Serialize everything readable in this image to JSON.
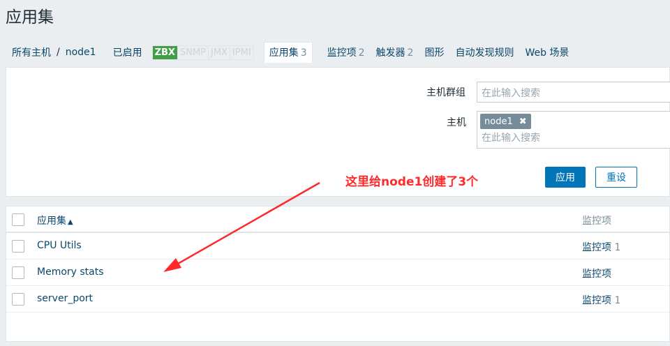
{
  "page": {
    "title": "应用集"
  },
  "nav": {
    "all_hosts": "所有主机",
    "separator": "/",
    "host": "node1",
    "status": "已启用",
    "availability": [
      "ZBX",
      "SNMP",
      "JMX",
      "IPMI"
    ],
    "tabs": [
      {
        "label": "应用集",
        "count": "3",
        "active": true
      },
      {
        "label": "监控项",
        "count": "2",
        "active": false
      },
      {
        "label": "触发器",
        "count": "2",
        "active": false
      },
      {
        "label": "图形",
        "count": "",
        "active": false
      },
      {
        "label": "自动发现规则",
        "count": "",
        "active": false
      },
      {
        "label": "Web 场景",
        "count": "",
        "active": false
      }
    ]
  },
  "filter": {
    "host_group_label": "主机群组",
    "host_group_placeholder": "在此输入搜索",
    "host_label": "主机",
    "host_chip": "node1",
    "host_chip_remove": "✖",
    "host_placeholder": "在此输入搜索",
    "apply": "应用",
    "reset": "重设"
  },
  "table": {
    "col_name": "应用集",
    "sort_arrow": "▲",
    "col_items": "监控项",
    "rows": [
      {
        "name": "CPU Utils",
        "items_label": "监控项",
        "items_count": "1"
      },
      {
        "name": "Memory stats",
        "items_label": "监控项",
        "items_count": ""
      },
      {
        "name": "server_port",
        "items_label": "监控项",
        "items_count": "1"
      }
    ]
  },
  "annotation": {
    "text": "这里给node1创建了3个",
    "color": "#ff2a2a"
  },
  "colors": {
    "link": "#0a466a",
    "primary": "#0275b8",
    "enabled": "#429e47"
  }
}
